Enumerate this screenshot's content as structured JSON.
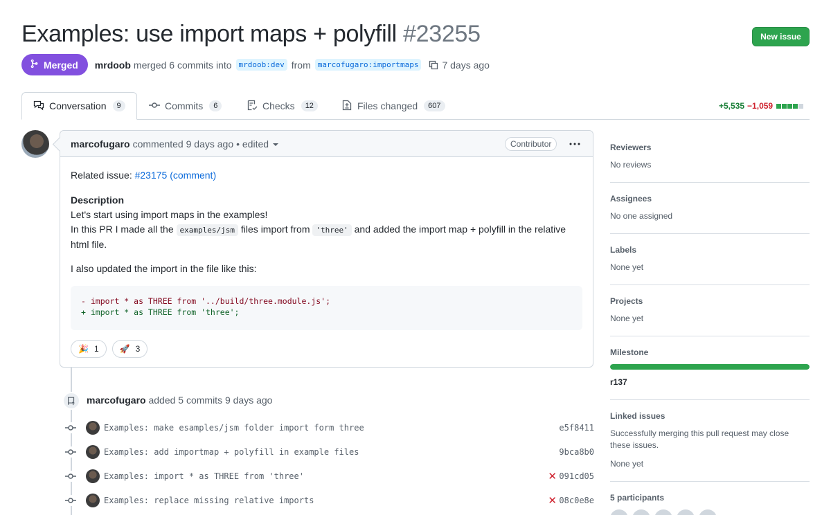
{
  "pr": {
    "title": "Examples: use import maps + polyfill",
    "number": "#23255",
    "state": "Merged",
    "author": "mrdoob",
    "merged_text": "merged 6 commits into",
    "base_branch": "mrdoob:dev",
    "from_text": "from",
    "head_branch": "marcofugaro:importmaps",
    "time": "7 days ago"
  },
  "header": {
    "new_issue_label": "New issue"
  },
  "tabs": [
    {
      "label": "Conversation",
      "count": "9",
      "icon": "conversation-icon"
    },
    {
      "label": "Commits",
      "count": "6",
      "icon": "commit-icon"
    },
    {
      "label": "Checks",
      "count": "12",
      "icon": "checklist-icon"
    },
    {
      "label": "Files changed",
      "count": "607",
      "icon": "file-diff-icon"
    }
  ],
  "diffstat": {
    "additions": "+5,535",
    "deletions": "−1,059",
    "colors": [
      "#2da44e",
      "#2da44e",
      "#2da44e",
      "#2da44e",
      "#d0d7de"
    ]
  },
  "comment": {
    "author": "marcofugaro",
    "action": "commented 9 days ago",
    "edited": "• edited",
    "badge": "Contributor",
    "related_label": "Related issue:",
    "related_link": "#23175 (comment)",
    "heading": "Description",
    "line1": "Let's start using import maps in the examples!",
    "line2_a": "In this PR I made all the",
    "line2_code1": "examples/jsm",
    "line2_b": "files import from",
    "line2_code2": "'three'",
    "line2_c": "and added the import map + polyfill in the relative",
    "line3": "html file.",
    "line4": "I also updated the import in the file like this:",
    "code_removed": "- import * as THREE from '../build/three.module.js';",
    "code_added": "+ import * as THREE from 'three';",
    "reactions": [
      {
        "emoji": "🎉",
        "count": "1"
      },
      {
        "emoji": "🚀",
        "count": "3"
      }
    ]
  },
  "push_event": {
    "author": "marcofugaro",
    "text": "added 5 commits 9 days ago"
  },
  "commits": [
    {
      "message": "Examples: make esamples/jsm folder import form three",
      "sha": "e5f8411",
      "failed": ""
    },
    {
      "message": "Examples: add importmap + polyfill in example files",
      "sha": "9bca8b0",
      "failed": ""
    },
    {
      "message": "Examples: import * as THREE from 'three'",
      "sha": "091cd05",
      "failed": "✕"
    },
    {
      "message": "Examples: replace missing relative imports",
      "sha": "08c0e8e",
      "failed": "✕"
    }
  ],
  "sidebar": {
    "reviewers": {
      "title": "Reviewers",
      "value": "No reviews"
    },
    "assignees": {
      "title": "Assignees",
      "value": "No one assigned"
    },
    "labels": {
      "title": "Labels",
      "value": "None yet"
    },
    "projects": {
      "title": "Projects",
      "value": "None yet"
    },
    "milestone": {
      "title": "Milestone",
      "value": "r137",
      "progress": 1.0
    },
    "linked": {
      "title": "Linked issues",
      "description": "Successfully merging this pull request may close these issues.",
      "value": "None yet"
    },
    "participants": {
      "title": "5 participants"
    }
  }
}
